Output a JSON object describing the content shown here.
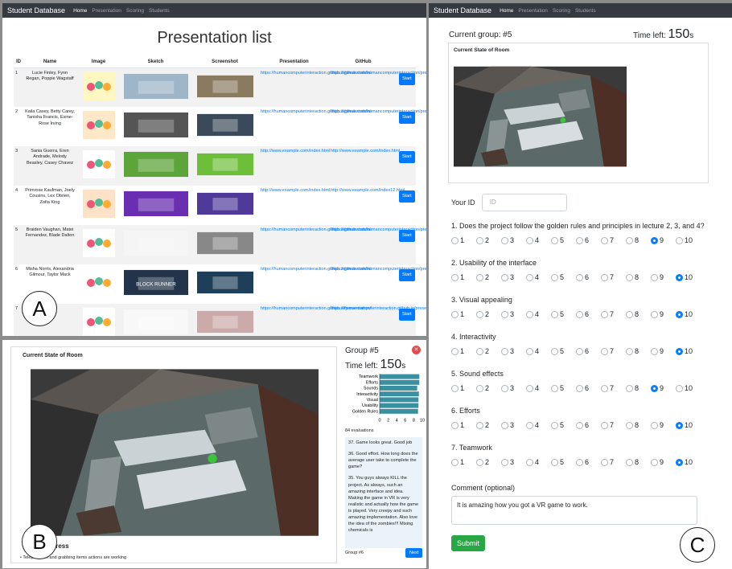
{
  "nav": {
    "brand": "Student Database",
    "items": [
      "Home",
      "Presentation",
      "Scoring",
      "Students"
    ]
  },
  "panelA": {
    "title": "Presentation list",
    "headers": [
      "ID",
      "Name",
      "Image",
      "Sketch",
      "Screenshot",
      "Presentation",
      "GitHub",
      ""
    ],
    "rows": [
      {
        "id": "1",
        "name": "Lucie Finley, Fynn Regan, Poppie Wagstaff",
        "pres": "https://humancomputerinteraction.github.io/presentation/",
        "git": "https://github.com/humancomputerinteraction/presentation1",
        "btn": "Start"
      },
      {
        "id": "2",
        "name": "Kaila Casey, Betty Carey, Tanisha Francis, Esme-Rose Irving",
        "pres": "https://humancomputerinteraction.github.io/presentation/",
        "git": "https://github.com/humancomputerinteraction/presentation2",
        "btn": "Start"
      },
      {
        "id": "3",
        "name": "Sania Guerra, Eren Andrade, Melody Beasley, Casey Chavez",
        "pres": "http://www.example.com/index.html",
        "git": "http://www.example.com/index.html",
        "btn": "Start"
      },
      {
        "id": "4",
        "name": "Primrose Kaufman, Joely Cousins, Lex Obrien, Zofia King",
        "pres": "http://www.example.com/index.html",
        "git": "http://www.example.com/index12.html",
        "btn": "Start"
      },
      {
        "id": "5",
        "name": "Braiden Vaughan, Matei Fernandez, Blade Dalton",
        "pres": "https://humancomputerinteraction.github.io/presentation/",
        "git": "https://github.com/humancomputerinteraction/presentation",
        "btn": "Start"
      },
      {
        "id": "6",
        "name": "Misha Norris, Alexandria Gilmour, Taylor Mack",
        "pres": "https://humancomputerinteraction.github.io/presentation/",
        "git": "https://github.com/humancomputerinteraction/presentation",
        "btn": "Start"
      },
      {
        "id": "7",
        "name": "",
        "pres": "https://humancomputerinteraction.github.io/presentation/",
        "git": "https://humancomputerinteraction.github.io/presentation/",
        "btn": "Start"
      }
    ],
    "sketch6_text": "BLOCK RUNNER",
    "label": "A"
  },
  "panelB": {
    "card_title": "Current State of Room",
    "group": "Group #5",
    "time_label": "Time left:",
    "time_value": "150",
    "time_unit": "s",
    "progress_title": "Progress",
    "progress_item": "Teleportation and grabbing items actions are working",
    "chart_data": {
      "type": "bar",
      "orientation": "horizontal",
      "categories": [
        "Teamwork",
        "Efforts",
        "Sounds",
        "Interactivity",
        "Visual",
        "Usability",
        "Golden Rules"
      ],
      "values": [
        9.3,
        9.3,
        8.8,
        9.2,
        9.1,
        9.1,
        9.0
      ],
      "xlim": [
        0,
        10
      ],
      "xticks": [
        "0",
        "2",
        "4",
        "6",
        "8",
        "10"
      ],
      "bar_color": "#3a8fa0"
    },
    "evaluations": "84 evaluations",
    "comments": [
      "37. Game looks great. Good job",
      "36. Good effort. How long does the average user take to complete the game?",
      "35. You guys always KILL the project. As always, such an amazing interface and idea. Making the game in VR is very realistic and actually how the game is played. Very creepy and such amazing implementation. Also love the idea of the zombies!!! Mixing chemicals is"
    ],
    "next_group": "Group #6",
    "next_btn": "Next",
    "label": "B"
  },
  "panelC": {
    "current_group": "Current group: #5",
    "time_label": "Time left:",
    "time_value": "150",
    "time_unit": "s",
    "card_title": "Current State of Room",
    "id_label": "Your ID",
    "id_placeholder": "ID",
    "questions": [
      {
        "text": "1. Does the project follow the golden rules and principles in lecture 2, 3, and 4?",
        "selected": 9
      },
      {
        "text": "2. Usability of the interface",
        "selected": 10
      },
      {
        "text": "3. Visual appealing",
        "selected": 10
      },
      {
        "text": "4. Interactivity",
        "selected": 10
      },
      {
        "text": "5. Sound effects",
        "selected": 9
      },
      {
        "text": "6. Efforts",
        "selected": 10
      },
      {
        "text": "7. Teamwork",
        "selected": 10
      }
    ],
    "options": [
      "1",
      "2",
      "3",
      "4",
      "5",
      "6",
      "7",
      "8",
      "9",
      "10"
    ],
    "comment_label": "Comment (optional)",
    "comment_value": "It is amazing how you got a VR game to work.",
    "submit": "Submit",
    "label": "C"
  }
}
